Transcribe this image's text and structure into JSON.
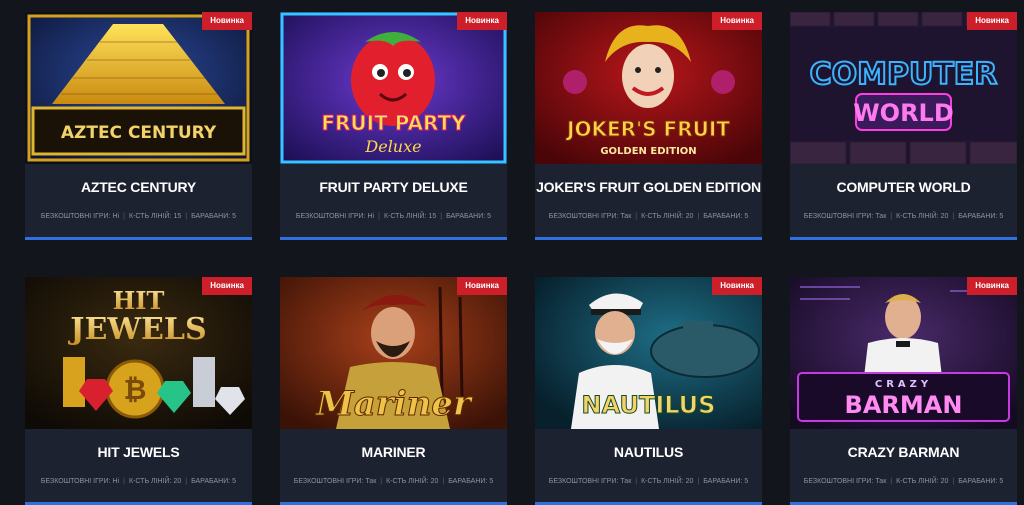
{
  "badge_label": "Новинка",
  "accent_color": "#2f6fe0",
  "badge_color": "#cc1f2a",
  "meta_labels": {
    "free_games": "БЕЗКОШТОВНІ ІГРИ:",
    "lines": "К-СТЬ ЛІНІЙ:",
    "reels": "БАРАБАНИ:"
  },
  "games": [
    {
      "title": "AZTEC CENTURY",
      "logo_lines": [
        "AZTEC CENTURY"
      ],
      "free_games": "Ні",
      "lines": "15",
      "reels": "5",
      "icon": "pyramid-artwork"
    },
    {
      "title": "FRUIT PARTY DELUXE",
      "logo_lines": [
        "FRUIT PARTY",
        "Deluxe"
      ],
      "free_games": "Ні",
      "lines": "15",
      "reels": "5",
      "icon": "strawberry-artwork"
    },
    {
      "title": "JOKER'S FRUIT GOLDEN EDITION",
      "logo_lines": [
        "JOKER'S FRUIT",
        "GOLDEN EDITION"
      ],
      "free_games": "Так",
      "lines": "20",
      "reels": "5",
      "icon": "joker-artwork"
    },
    {
      "title": "COMPUTER WORLD",
      "logo_lines": [
        "COMPUTER",
        "WORLD"
      ],
      "free_games": "Так",
      "lines": "20",
      "reels": "5",
      "icon": "neon-sign-artwork"
    },
    {
      "title": "HIT JEWELS",
      "logo_lines": [
        "HIT",
        "JEWELS"
      ],
      "free_games": "Ні",
      "lines": "20",
      "reels": "5",
      "icon": "gems-artwork"
    },
    {
      "title": "MARINER",
      "logo_lines": [
        "Mariner"
      ],
      "free_games": "Так",
      "lines": "20",
      "reels": "5",
      "icon": "pirate-artwork"
    },
    {
      "title": "NAUTILUS",
      "logo_lines": [
        "NAUTILUS"
      ],
      "free_games": "Так",
      "lines": "20",
      "reels": "5",
      "icon": "captain-artwork"
    },
    {
      "title": "CRAZY BARMAN",
      "logo_lines": [
        "CRAZY",
        "BARMAN"
      ],
      "free_games": "Так",
      "lines": "20",
      "reels": "5",
      "icon": "barman-artwork"
    }
  ]
}
